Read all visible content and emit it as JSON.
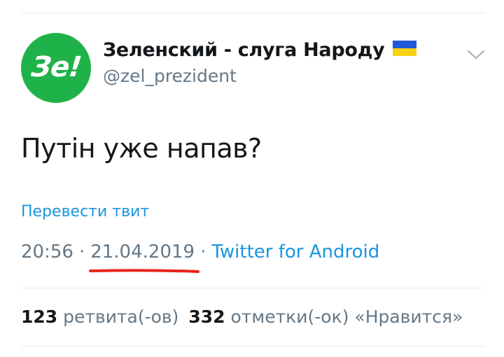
{
  "author": {
    "avatar_text": "Зе!",
    "display_name": "Зеленский - слуга Народу",
    "handle": "@zel_prezident",
    "flag_icon": "ukraine-flag-icon"
  },
  "tweet": {
    "text": "Путін уже напав?",
    "translate_label": "Перевести твит",
    "time": "20:56",
    "separator": "·",
    "date": "21.04.2019",
    "source": "Twitter for Android"
  },
  "stats": {
    "retweets_count": "123",
    "retweets_label": "ретвита(-ов)",
    "likes_count": "332",
    "likes_label": "отметки(-ок) «Нравится»"
  },
  "colors": {
    "avatar_green": "#1fb249",
    "link_blue": "#1b95e0",
    "text_primary": "#14171a",
    "text_secondary": "#657786",
    "underline_red": "#e8231c"
  },
  "icons": {
    "more_menu": "chevron-down-icon"
  }
}
